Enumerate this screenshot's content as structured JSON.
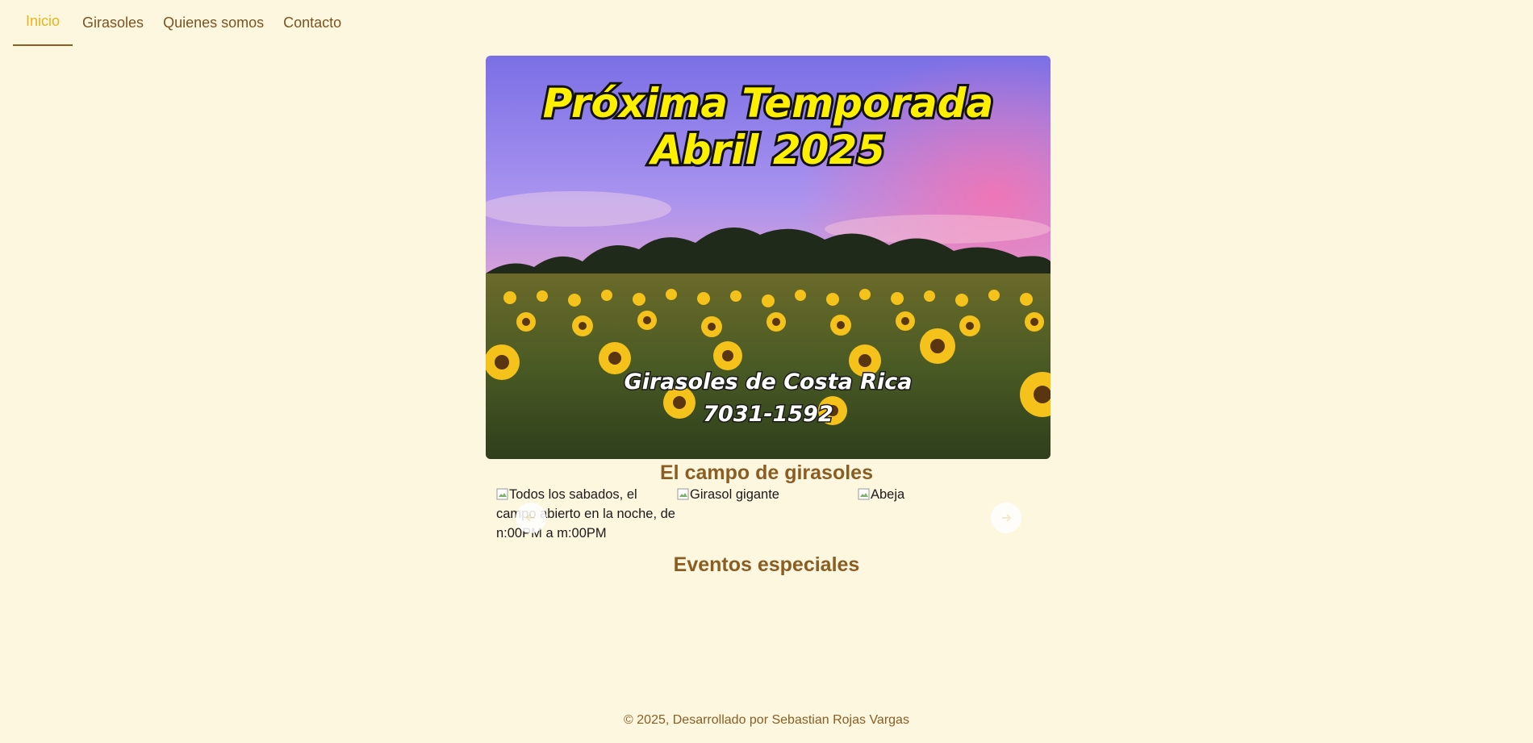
{
  "nav": {
    "items": [
      {
        "label": "Inicio",
        "active": true
      },
      {
        "label": "Girasoles",
        "active": false
      },
      {
        "label": "Quienes somos",
        "active": false
      },
      {
        "label": "Contacto",
        "active": false
      }
    ]
  },
  "hero": {
    "title_line1": "Próxima Temporada",
    "title_line2": "Abril 2025",
    "brand": "Girasoles de Costa Rica",
    "phone": "7031-1592"
  },
  "sections": {
    "campo_title": "El campo de girasoles",
    "eventos_title": "Eventos especiales"
  },
  "carousel": {
    "slides": [
      {
        "alt": "Todos los sabados, el campo abierto en la noche, de n:00PM a m:00PM"
      },
      {
        "alt": "Girasol gigante"
      },
      {
        "alt": "Abeja"
      }
    ],
    "prev_icon": "arrow-left-icon",
    "next_icon": "arrow-right-icon"
  },
  "footer": {
    "text": "© 2025, Desarrollado por Sebastian Rojas Vargas"
  },
  "colors": {
    "background": "#fef7e0",
    "accent": "#e8b31e",
    "brown": "#8a5d23"
  }
}
